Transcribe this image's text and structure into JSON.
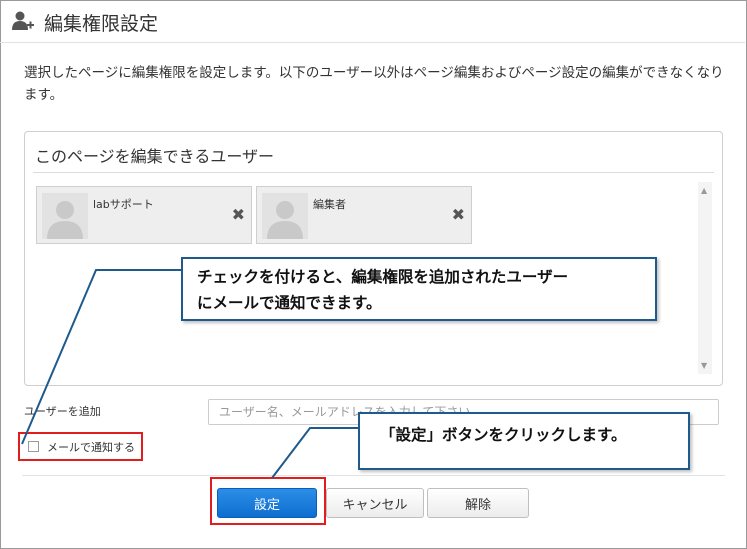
{
  "dialog": {
    "title": "編集権限設定",
    "title_icon": "add-user-icon"
  },
  "description": "選択したページに編集権限を設定します。以下のユーザー以外はページ編集およびページ設定の編集ができなくなります。",
  "editors_panel": {
    "title": "このページを編集できるユーザー",
    "users": [
      {
        "name": "labサポート",
        "avatar_icon": "user-silhouette-icon",
        "remove_icon": "close-icon"
      },
      {
        "name": "編集者",
        "avatar_icon": "user-silhouette-icon",
        "remove_icon": "close-icon"
      }
    ]
  },
  "add_user": {
    "label": "ユーザーを追加",
    "placeholder": "ユーザー名、メールアドレスを入力して下さい",
    "value": ""
  },
  "notify": {
    "label": "メールで通知する",
    "checked": false
  },
  "buttons": {
    "set": "設定",
    "cancel": "キャンセル",
    "release": "解除"
  },
  "callouts": {
    "notify_line1": "チェックを付けると、編集権限を追加されたユーザー",
    "notify_line2": "にメールで通知できます。",
    "set": "「設定」ボタンをクリックします。"
  },
  "colors": {
    "primary_button": "#1a7fdc",
    "highlight_box": "#e01e1e",
    "callout_border": "#1e5b8c"
  }
}
